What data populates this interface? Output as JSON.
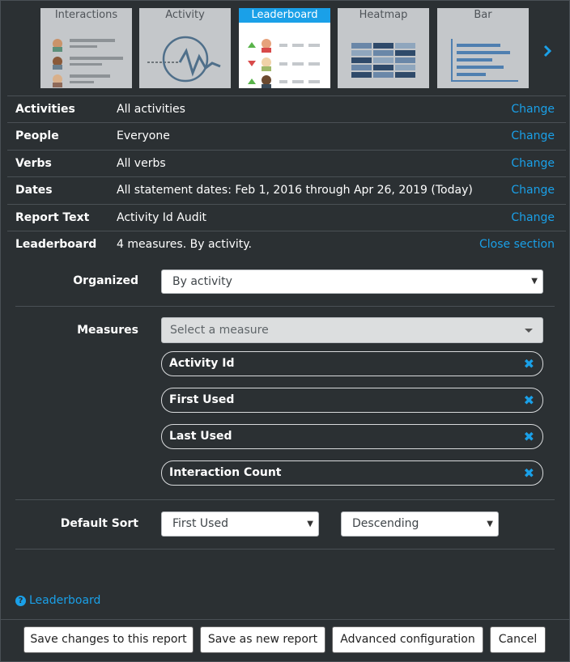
{
  "tabs": [
    {
      "label": "Interactions",
      "active": false
    },
    {
      "label": "Activity",
      "active": false
    },
    {
      "label": "Leaderboard",
      "active": true
    },
    {
      "label": "Heatmap",
      "active": false
    },
    {
      "label": "Bar",
      "active": false
    }
  ],
  "settings": [
    {
      "label": "Activities",
      "value": "All activities",
      "action": "Change"
    },
    {
      "label": "People",
      "value": "Everyone",
      "action": "Change"
    },
    {
      "label": "Verbs",
      "value": "All verbs",
      "action": "Change"
    },
    {
      "label": "Dates",
      "value": "All statement dates: Feb 1, 2016 through Apr 26, 2019 (Today)",
      "action": "Change"
    },
    {
      "label": "Report Text",
      "value": "Activity Id Audit",
      "action": "Change"
    },
    {
      "label": "Leaderboard",
      "value": "4 measures. By activity.",
      "action": "Close section"
    }
  ],
  "organized": {
    "label": "Organized",
    "value": "By activity"
  },
  "measures": {
    "label": "Measures",
    "placeholder": "Select a measure",
    "items": [
      "Activity Id",
      "First Used",
      "Last Used",
      "Interaction Count"
    ]
  },
  "sort": {
    "label": "Default Sort",
    "field": "First Used",
    "direction": "Descending"
  },
  "help": {
    "label": "Leaderboard"
  },
  "buttons": {
    "save": "Save changes to this report",
    "save_new": "Save as new report",
    "advanced": "Advanced configuration",
    "cancel": "Cancel"
  },
  "colors": {
    "accent": "#1aa0e8",
    "background": "#2b3033",
    "divider": "#4a5055"
  }
}
